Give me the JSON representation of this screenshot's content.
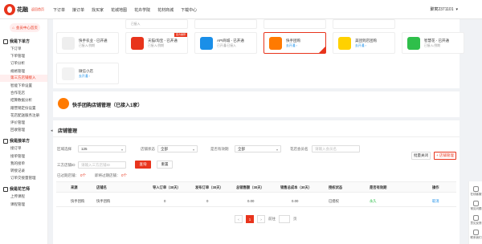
{
  "header": {
    "logo_text": "花融",
    "logo_sub": "返回首页",
    "nav": [
      "下订单",
      "接订单",
      "找买家",
      "花城地图",
      "花卉学院",
      "花材商城",
      "下载中心"
    ],
    "user": "聚寓2371101"
  },
  "sidebar": {
    "member_center": "会员中心首页",
    "groups": [
      {
        "title": "我是下单方",
        "items": [
          "下订单",
          "下单管理",
          "订单分析",
          "规格管理",
          "第三方店铺接入",
          "智能下单设置",
          "合作花店",
          "结算数据分析",
          "蹭营销定份设置",
          "花店配送服务注册",
          "评价管理",
          "回收管理"
        ]
      },
      {
        "title": "我是接单方",
        "items": [
          "接订单",
          "接单管理",
          "我的接单",
          "转接记录",
          "订单交接量管理"
        ]
      },
      {
        "title": "我是花艺师",
        "items": [
          "上传课程",
          "课程管理"
        ]
      }
    ],
    "active_item": "第三方店铺接入"
  },
  "platforms_row1": [
    {
      "name": "",
      "status": "已接入",
      "icon": "blank-icon",
      "color": "#e8341c"
    },
    {
      "name": "",
      "status": "",
      "icon": "aliexpress-icon",
      "color": "#e8341c"
    },
    {
      "name": "",
      "status": "",
      "icon": "blank-icon",
      "color": "#e8341c"
    },
    {
      "name": "",
      "status": "",
      "icon": "meituan-icon",
      "color": "#ffd100"
    },
    {
      "name": "",
      "status": "",
      "icon": "eleme-icon",
      "color": "#1a8fe8"
    }
  ],
  "platforms_row2": [
    {
      "name": "快手农业 - 已开通",
      "status": "已接入/到期",
      "icon": "image-placeholder-icon",
      "color": "#eee"
    },
    {
      "name": "天猫/淘宝 - 已开通",
      "status": "已接入/到期",
      "icon": "tmall-icon",
      "color": "#e8341c",
      "tag": "官方推荐"
    },
    {
      "name": "API商城 - 已开通",
      "status": "已开通/已接入",
      "icon": "api-icon",
      "color": "#1a8fe8"
    },
    {
      "name": "快手团购",
      "status": "去开通 ›",
      "icon": "kuaishou-icon",
      "color": "#ff7a00"
    },
    {
      "name": "美团到店团购",
      "status": "去开通 ›",
      "icon": "meituan-icon",
      "color": "#ffd100"
    },
    {
      "name": "智慧花 - 已开通",
      "status": "已接入/到期",
      "icon": "shop-bag-icon",
      "color": "#2fbf4b"
    }
  ],
  "platforms_row3": [
    {
      "name": "微信小店",
      "status": "去开通 ›",
      "icon": "image-placeholder-icon",
      "color": "#f2f2f2"
    }
  ],
  "mgmt": {
    "title": "快手团购店铺管理（已接入1家）",
    "list_title": "店铺管理"
  },
  "filters": {
    "region_label": "区域选择",
    "region_value": "125",
    "type_label": "店铺状态",
    "type_value": "全部",
    "settle_label": "是否有效期",
    "settle_value": "全部",
    "search_label": "花店会员名",
    "search_ph": "请输入会员名",
    "shop_label": "三方店铺ID",
    "shop_ph": "请输入三方店铺ID",
    "query_btn": "查询",
    "reset_btn": "重置",
    "btn_right1": "批量关闭",
    "btn_right2": "+ 店铺管理",
    "summary1": "已过期店铺：",
    "summary1_val": "0个",
    "summary2": "即将过期店铺：",
    "summary2_val": "0个"
  },
  "table": {
    "columns": [
      "来源",
      "店铺名",
      "导入订单（30天）",
      "发布订单（30天）",
      "总销售额（30天）",
      "销售总成本（30天）",
      "授权状态",
      "是否有效期",
      "操作"
    ],
    "rows": [
      [
        "快手团购",
        "快手团购",
        "0",
        "0",
        "0.00",
        "0.00",
        "已授权",
        "永久",
        "取消"
      ]
    ]
  },
  "pager": {
    "prev": "‹",
    "page": "1",
    "next": "›",
    "goto": "前往",
    "unit": "页"
  },
  "floatbar": [
    "在线客服",
    "常见问题",
    "意见反馈",
    "联系我们"
  ]
}
